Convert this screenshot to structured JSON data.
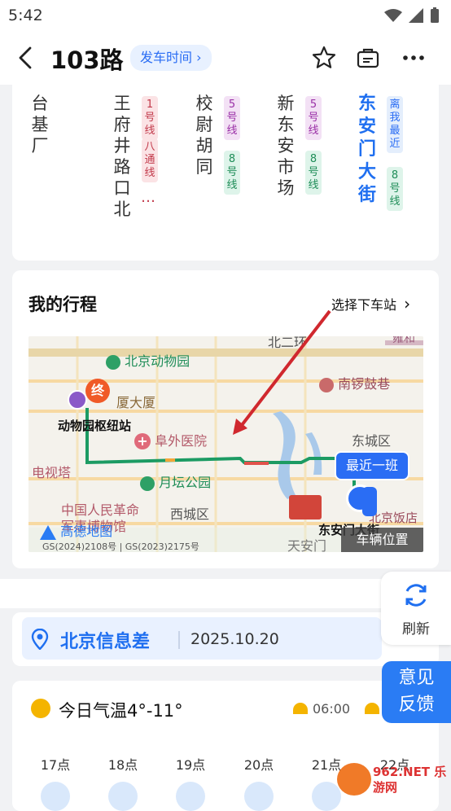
{
  "status_bar": {
    "time": "5:42"
  },
  "header": {
    "title": "103路",
    "schedule_label": "发车时间"
  },
  "stops": [
    {
      "name": "台基厂"
    },
    {
      "name": "王府井路口北",
      "tags": [
        "1号线",
        "八通线"
      ],
      "more": "…"
    },
    {
      "name": "校尉胡同",
      "tags": [
        "5号线",
        "8号线"
      ]
    },
    {
      "name": "新东安市场",
      "tags": [
        "5号线",
        "8号线"
      ]
    },
    {
      "name": "东安门大街",
      "tags": [
        "离我最近",
        "8号线"
      ]
    }
  ],
  "trip": {
    "title": "我的行程",
    "select_stop_label": "选择下车站",
    "map": {
      "labels": {
        "zoo": "北京动物园",
        "road_north": "北二环",
        "yonghe": "雍和",
        "nanluo": "南锣鼓巷",
        "building": "厦大厦",
        "hub": "动物园枢纽站",
        "fuwai": "阜外医院",
        "dongcheng": "东城区",
        "tv_tower": "电视塔",
        "yuetan": "月坛公园",
        "museum": "中国人民革命",
        "museum2": "军事博物馆",
        "xicheng": "西城区",
        "hotel": "北京饭店",
        "tiananmen": "天安门",
        "stop_label": "东安门大街",
        "brand": "高德地图",
        "license": "GS(2024)2108号 | GS(2023)2175号"
      },
      "end_marker": "终",
      "nearest_bus_label": "最近一班",
      "vehicle_position_label": "车辆位置"
    }
  },
  "info": {
    "title": "北京信息差",
    "date": "2025.10.20"
  },
  "weather": {
    "today_temp": "今日气温4°-11°",
    "sunrise": "06:00",
    "hours": [
      "17点",
      "18点",
      "19点",
      "20点",
      "21点",
      "22点"
    ]
  },
  "floating": {
    "refresh_label": "刷新",
    "feedback_line1": "意见",
    "feedback_line2": "反馈"
  },
  "watermark": "962.NET 乐游网",
  "colors": {
    "accent": "#2a7cf4",
    "route_green": "#1c9b63",
    "end_marker": "#f05a28"
  }
}
